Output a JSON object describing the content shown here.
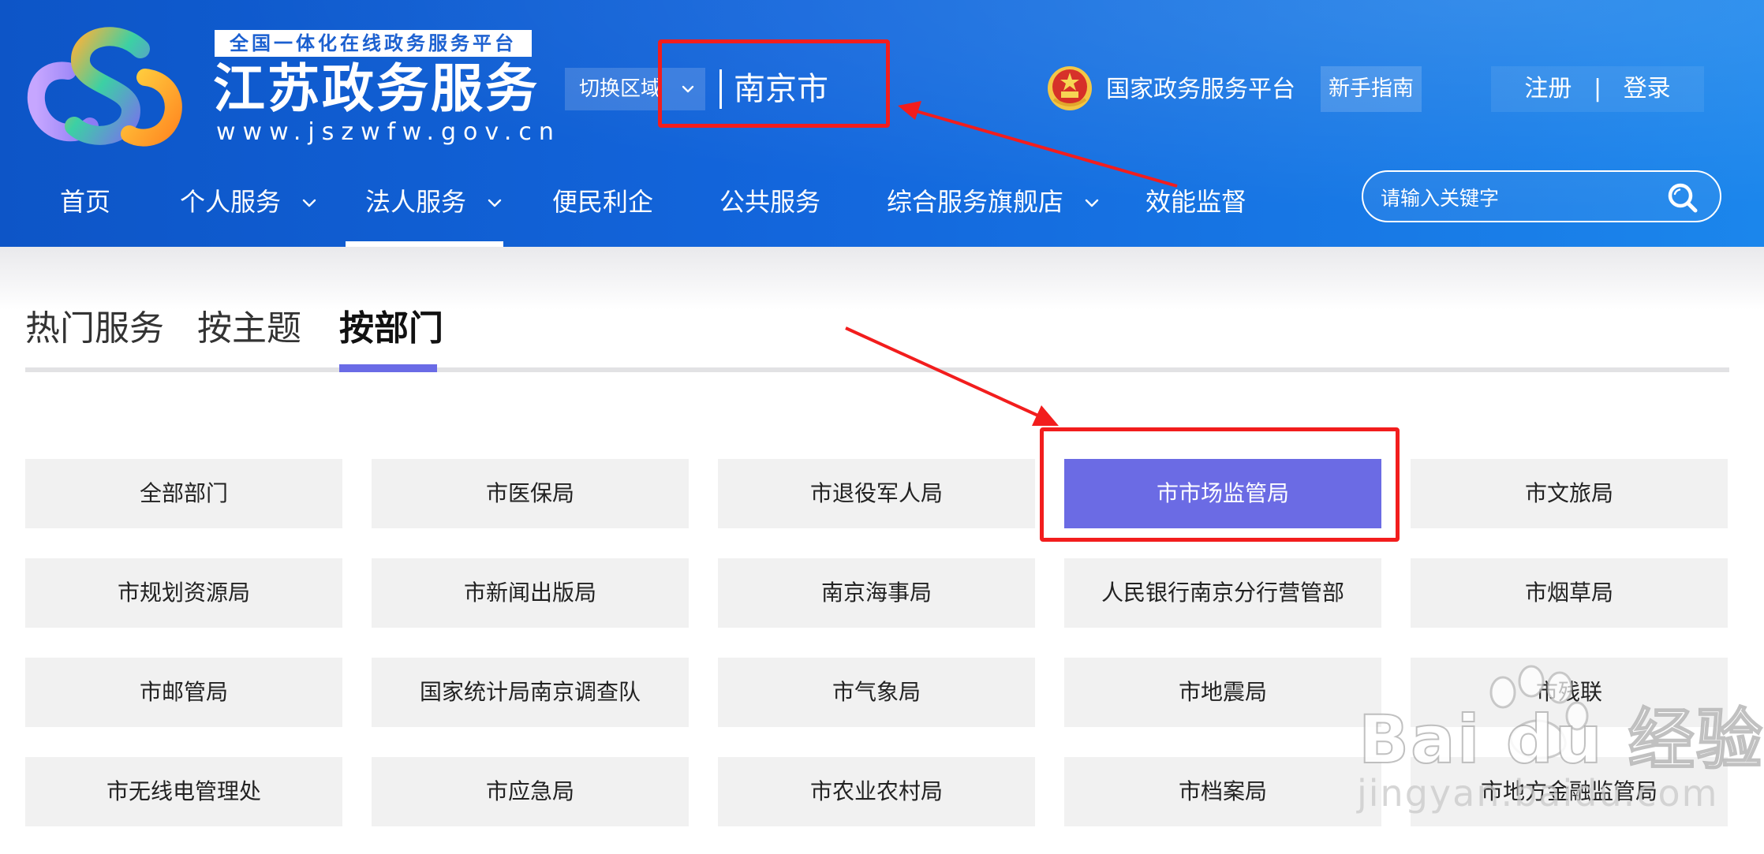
{
  "header": {
    "slogan": "全国一体化在线政务服务平台",
    "title": "江苏政务服务",
    "domain": "www.jszwfw.gov.cn",
    "region_switch_label": "切换区域",
    "current_region": "南京市",
    "national_platform_label": "国家政务服务平台",
    "guide_label": "新手指南",
    "register_label": "注册",
    "auth_separator": "|",
    "login_label": "登录"
  },
  "nav": {
    "items": [
      {
        "label": "首页"
      },
      {
        "label": "个人服务"
      },
      {
        "label": "法人服务"
      },
      {
        "label": "便民利企"
      },
      {
        "label": "公共服务"
      },
      {
        "label": "综合服务旗舰店"
      },
      {
        "label": "效能监督"
      }
    ],
    "active": "法人服务"
  },
  "search": {
    "placeholder": "请输入关键字"
  },
  "tabs": [
    {
      "label": "热门服务"
    },
    {
      "label": "按主题"
    },
    {
      "label": "按部门"
    }
  ],
  "active_tab": "按部门",
  "departments": [
    "全部部门",
    "市医保局",
    "市退役军人局",
    "市市场监管局",
    "市文旅局",
    "市规划资源局",
    "市新闻出版局",
    "南京海事局",
    "人民银行南京分行营管部",
    "市烟草局",
    "市邮管局",
    "国家统计局南京调查队",
    "市气象局",
    "市地震局",
    "市残联",
    "市无线电管理处",
    "市应急局",
    "市农业农村局",
    "市档案局",
    "市地方金融监管局"
  ],
  "selected_department": "市市场监管局",
  "watermark": {
    "brand": "Bai du 经验",
    "url": "jingyan.baidu.com"
  },
  "colors": {
    "header_blue": "#1366dc",
    "accent_purple": "#6b6be4",
    "annotation_red": "#f21d1d",
    "tile_gray": "#f1f1f1"
  }
}
